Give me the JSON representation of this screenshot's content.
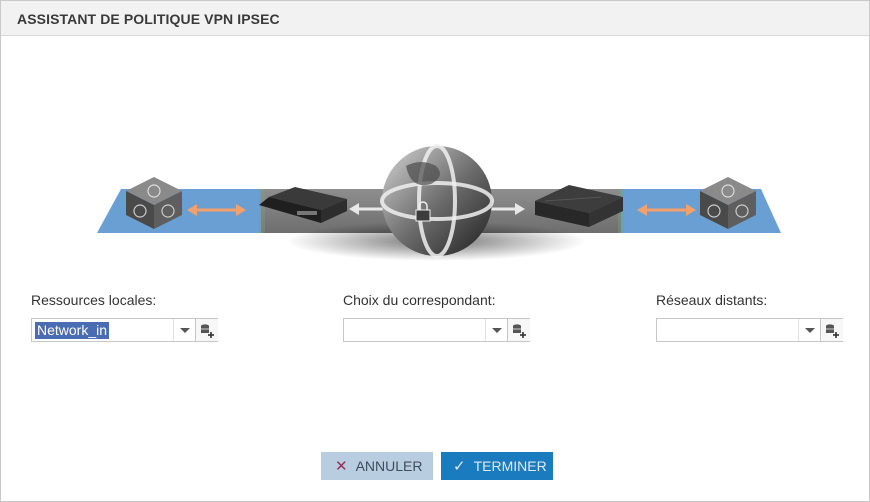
{
  "dialog": {
    "title": "ASSISTANT DE POLITIQUE VPN IPSEC"
  },
  "diagram": {
    "icons": [
      "local-network-cube-icon",
      "firewall-appliance-icon",
      "internet-globe-lock-icon",
      "remote-appliance-icon",
      "remote-network-cube-icon"
    ],
    "colors": {
      "local_zone": "#6a9fd4",
      "center_zone": "#8a8a8a",
      "remote_zone": "#6a9fd4",
      "arrow": "#f4a06a"
    }
  },
  "fields": {
    "local": {
      "label": "Ressources locales:",
      "value": "Network_in"
    },
    "peer": {
      "label": "Choix du correspondant:",
      "value": ""
    },
    "remote": {
      "label": "Réseaux distants:",
      "value": ""
    }
  },
  "buttons": {
    "cancel": "ANNULER",
    "finish": "TERMINER"
  },
  "colors": {
    "cancel_bg": "#b9cde0",
    "finish_bg": "#1a7bbf",
    "selection": "#4a6cb3"
  }
}
